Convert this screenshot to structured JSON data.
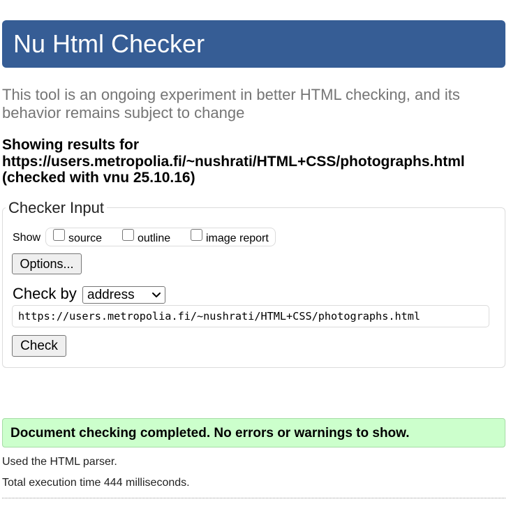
{
  "banner": {
    "title": "Nu Html Checker"
  },
  "intro": {
    "text": "This tool is an ongoing experiment in better HTML checking, and its behavior remains subject to change"
  },
  "results": {
    "line1": "Showing results for",
    "url": "https://users.metropolia.fi/~nushrati/HTML+CSS/photographs.html",
    "line3": "(checked with vnu 25.10.16)"
  },
  "checker_input": {
    "legend": "Checker Input",
    "show_label": "Show",
    "show_options": [
      {
        "label": "source",
        "checked": false
      },
      {
        "label": "outline",
        "checked": false
      },
      {
        "label": "image report",
        "checked": false
      }
    ],
    "options_button": "Options...",
    "check_by_label": "Check by",
    "check_by_value": "address",
    "url_value": "https://users.metropolia.fi/~nushrati/HTML+CSS/photographs.html",
    "check_button": "Check"
  },
  "status": {
    "message": "Document checking completed. No errors or warnings to show.",
    "parser_note": "Used the HTML parser.",
    "exec_time": "Total execution time 444 milliseconds."
  },
  "colors": {
    "banner_bg": "#365d95",
    "success_bg": "#ccffcc",
    "intro_text": "#757575"
  }
}
